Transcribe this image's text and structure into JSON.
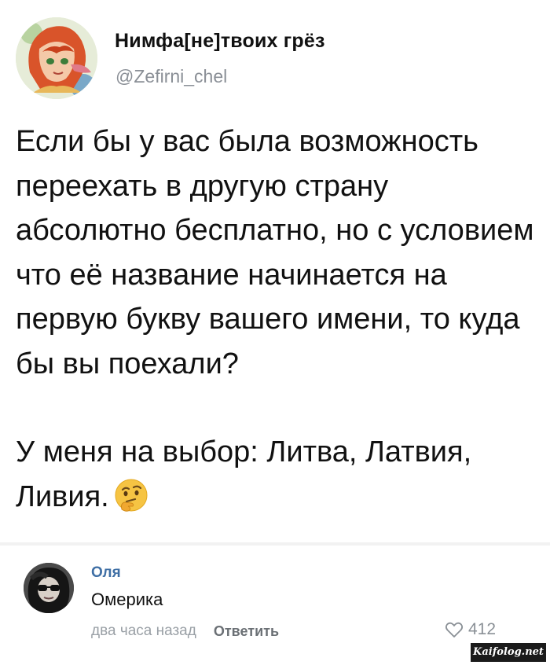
{
  "post": {
    "author_name": "Нимфа[не]твоих грёз",
    "author_handle": "@Zefirni_chel",
    "text_paragraph_1": "Если бы у вас была возможность переехать в другую страну абсолютно бесплатно, но с условием что её название начинается на первую букву вашего имени, то куда бы вы поехали?",
    "text_paragraph_2": "У меня на выбор: Литва, Латвия, Ливия.",
    "emoji_icon": "thinking-face-icon"
  },
  "comment": {
    "author": "Оля",
    "text": "Омерика",
    "time": "два часа назад",
    "reply_label": "Ответить",
    "likes": "412"
  },
  "watermark": "Kaifolog.net",
  "colors": {
    "comment_author": "#3f6fa5",
    "meta_gray": "#9aa0a6"
  }
}
